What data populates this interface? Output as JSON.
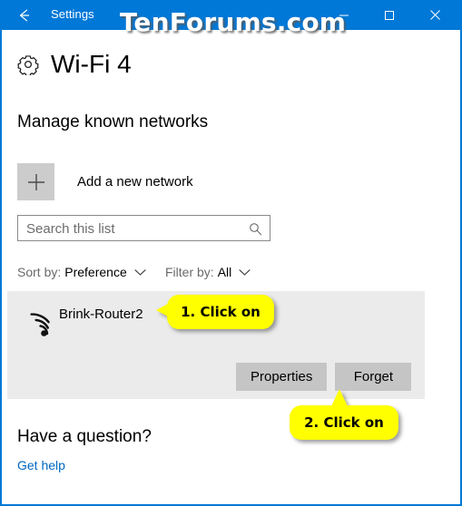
{
  "window": {
    "titlebar": {
      "title": "Settings",
      "back_icon": "back-arrow-icon",
      "minimize_icon": "minimize-icon",
      "maximize_icon": "maximize-icon",
      "close_icon": "close-icon",
      "background_color": "#0078d7",
      "text_color": "#ffffff"
    },
    "watermark": "TenForums.com"
  },
  "page": {
    "icon": "gear-icon",
    "title": "Wi-Fi 4",
    "section_heading": "Manage known networks",
    "add_network": {
      "icon": "plus-icon",
      "label": "Add a new network"
    },
    "search": {
      "placeholder": "Search this list",
      "value": "",
      "icon": "search-icon"
    },
    "sort": {
      "prefix": "Sort by:",
      "value": "Preference",
      "chevron": "chevron-down-icon"
    },
    "filter": {
      "prefix": "Filter by:",
      "value": "All",
      "chevron": "chevron-down-icon"
    },
    "networks": [
      {
        "icon": "wifi-signal-icon",
        "name": "Brink-Router2",
        "selected": true,
        "buttons": {
          "properties": "Properties",
          "forget": "Forget"
        }
      }
    ],
    "help": {
      "heading": "Have a question?",
      "link": "Get help",
      "link_color": "#0067c0"
    }
  },
  "annotations": [
    {
      "id": "callout-1",
      "text": "1. Click on",
      "color": "#ffff00",
      "points_to": "network-name"
    },
    {
      "id": "callout-2",
      "text": "2. Click on",
      "color": "#ffff00",
      "points_to": "forget-button"
    }
  ]
}
